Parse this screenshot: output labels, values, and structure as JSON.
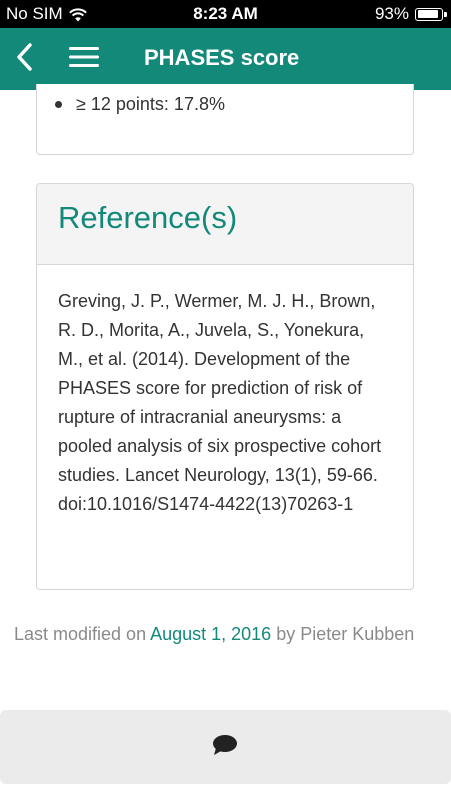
{
  "status_bar": {
    "carrier": "No SIM",
    "time": "8:23 AM",
    "battery": "93%",
    "battery_level": 0.93,
    "icons": [
      "wifi-icon",
      "battery-icon"
    ]
  },
  "nav": {
    "back_icon": "chevron-left-icon",
    "menu_icon": "hamburger-menu-icon",
    "title": "PHASES score"
  },
  "score_list": {
    "items": [
      {
        "text": "≥ 12 points: 17.8%"
      }
    ]
  },
  "reference": {
    "title": "Reference(s)",
    "text": "Greving, J. P., Wermer, M. J. H., Brown, R. D., Morita, A., Juvela, S., Yonekura, M., et al. (2014). Development of the PHASES score for prediction of risk of rupture of intracranial aneurysms: a pooled analysis of six prospective cohort studies. Lancet Neurology, 13(1), 59-66. doi:10.1016/S1474-4422(13)70263-1"
  },
  "footer": {
    "prefix": "Last modified on ",
    "date": "August 1, 2016",
    "suffix": " by Pieter Kubben"
  },
  "bottom_bar": {
    "icon": "chat-bubble-icon"
  },
  "colors": {
    "accent": "#13897a",
    "status_bar": "#000000",
    "muted_text": "#8a8a8a",
    "body_text": "#333333",
    "bottom_bar": "#ebebeb"
  }
}
